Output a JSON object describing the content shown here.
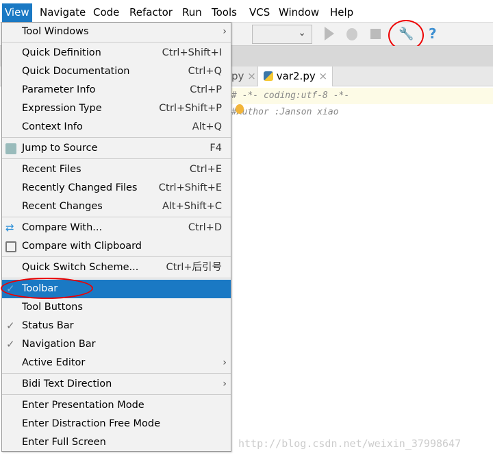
{
  "menubar": [
    "View",
    "Navigate",
    "Code",
    "Refactor",
    "Run",
    "Tools",
    "VCS",
    "Window",
    "Help"
  ],
  "tabs": {
    "partial": "py",
    "active": "var2.py",
    "close": "×"
  },
  "code": [
    "# -*- coding:utf-8 -*-",
    "#Author :Janson xiao"
  ],
  "toolbar": {
    "help": "?"
  },
  "menu": {
    "tool_windows": "Tool Windows",
    "quick_definition": {
      "label": "Quick Definition",
      "shortcut": "Ctrl+Shift+I"
    },
    "quick_documentation": {
      "label": "Quick Documentation",
      "shortcut": "Ctrl+Q"
    },
    "parameter_info": {
      "label": "Parameter Info",
      "shortcut": "Ctrl+P"
    },
    "expression_type": {
      "label": "Expression Type",
      "shortcut": "Ctrl+Shift+P"
    },
    "context_info": {
      "label": "Context Info",
      "shortcut": "Alt+Q"
    },
    "jump_to_source": {
      "label": "Jump to Source",
      "shortcut": "F4"
    },
    "recent_files": {
      "label": "Recent Files",
      "shortcut": "Ctrl+E"
    },
    "recently_changed": {
      "label": "Recently Changed Files",
      "shortcut": "Ctrl+Shift+E"
    },
    "recent_changes": {
      "label": "Recent Changes",
      "shortcut": "Alt+Shift+C"
    },
    "compare_with": {
      "label": "Compare With...",
      "shortcut": "Ctrl+D"
    },
    "compare_clipboard": {
      "label": "Compare with Clipboard"
    },
    "quick_switch": {
      "label": "Quick Switch Scheme...",
      "shortcut": "Ctrl+后引号"
    },
    "toolbar": "Toolbar",
    "tool_buttons": "Tool Buttons",
    "status_bar": "Status Bar",
    "navigation_bar": "Navigation Bar",
    "active_editor": "Active Editor",
    "bidi": "Bidi Text Direction",
    "presentation": "Enter Presentation Mode",
    "distraction": "Enter Distraction Free Mode",
    "full_screen": "Enter Full Screen",
    "check": "✓",
    "arrow": "›"
  },
  "watermark": "http://blog.csdn.net/weixin_37998647"
}
